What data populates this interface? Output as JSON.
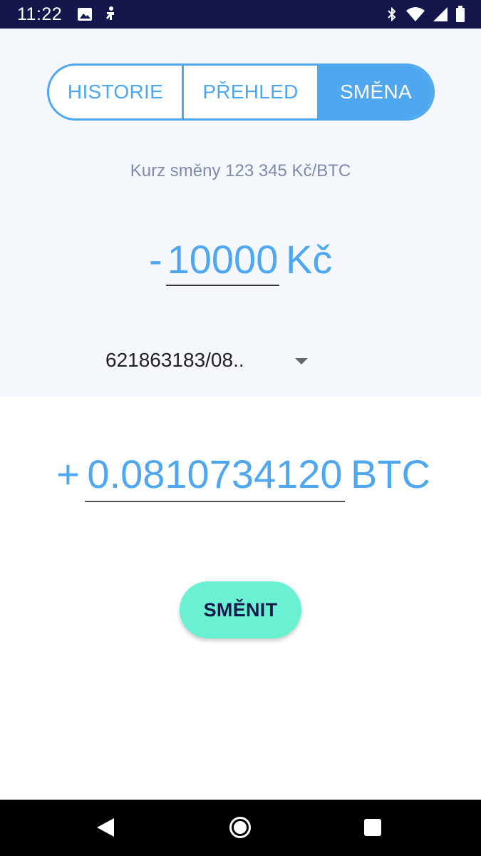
{
  "status_bar": {
    "time": "11:22",
    "left_icons": [
      "image-icon",
      "debug-icon"
    ],
    "right_icons": [
      "bluetooth-icon",
      "wifi-icon",
      "signal-icon",
      "battery-icon"
    ]
  },
  "tabs": [
    {
      "label": "HISTORIE",
      "selected": false
    },
    {
      "label": "PŘEHLED",
      "selected": false
    },
    {
      "label": "SMĚNA",
      "selected": true
    }
  ],
  "exchange_rate": "Kurz směny 123 345 Kč/BTC",
  "czk": {
    "sign": "-",
    "amount": "10000",
    "currency": "Kč"
  },
  "account": {
    "selected": "621863183/08.."
  },
  "btc": {
    "sign": "+",
    "amount": "0.0810734120",
    "currency": "BTC"
  },
  "exchange_button": {
    "label": "SMĚNIT"
  },
  "colors": {
    "accent": "#4ea7ef",
    "button": "#6af1d4",
    "status_bar": "#15174c",
    "top_background": "#f4f8fd"
  }
}
